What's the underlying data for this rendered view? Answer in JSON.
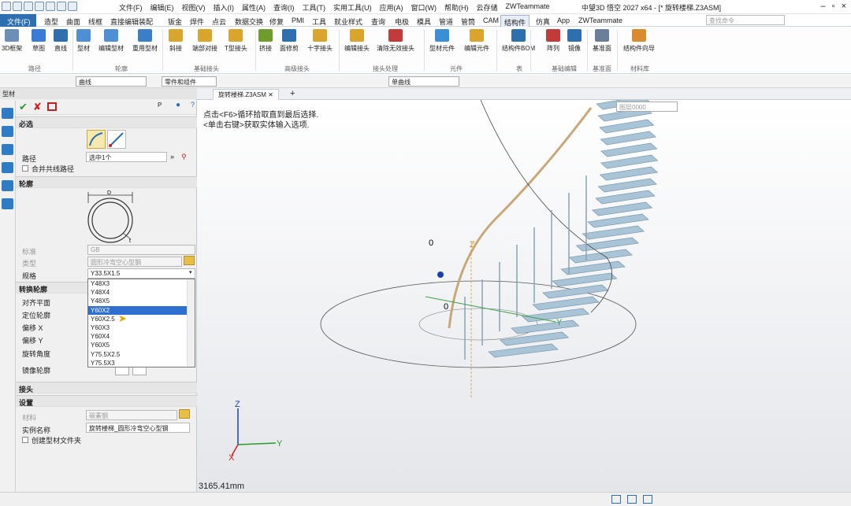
{
  "app": {
    "title": "中望3D 悟空 2027 x64 - [* 旋转楼梯.Z3ASM]"
  },
  "menu": [
    "文件(F)",
    "编辑(E)",
    "视图(V)",
    "插入(I)",
    "属性(A)",
    "查询(I)",
    "工具(T)",
    "实用工具(U)",
    "应用(A)",
    "窗口(W)",
    "帮助(H)",
    "云存储",
    "ZWTeammate"
  ],
  "ribbon_tabs": {
    "file": "文件(F)",
    "tabs": [
      "造型",
      "曲面",
      "线框",
      "直接编辑",
      "装配",
      "钣金",
      "焊件",
      "点云",
      "数据交换",
      "修复",
      "PMI",
      "工具",
      "就业样式",
      "查询",
      "电极",
      "模具",
      "管道",
      "管筒",
      "CAM",
      "结构件",
      "仿真",
      "App",
      "ZWTeammate"
    ]
  },
  "search_placeholder": "查找命令",
  "ribbon": {
    "buttons": [
      "3D框架",
      "草图",
      "直线",
      "型材",
      "编辑型材",
      "重用型材",
      "斜接",
      "端部对接",
      "T型接头",
      "挤接",
      "面修剪",
      "十字接头",
      "编辑接头",
      "清除无效接头",
      "型材元件",
      "编辑元件",
      "结构件BOM",
      "阵列",
      "镜像",
      "基准面",
      "结构件向导"
    ],
    "groups": [
      "路径",
      "轮廓",
      "基础接头",
      "高级接头",
      "接头处理",
      "元件",
      "表",
      "基础编辑",
      "基准面",
      "材料库"
    ]
  },
  "toolbar2": {
    "filter": "曲线",
    "filter2": "零件和组件",
    "select_mode": "单曲线",
    "layer": "图层0000"
  },
  "panel": {
    "title": "型材",
    "sec_required": "必选",
    "path_label": "路径",
    "path_value": "选中1个",
    "merge_label": "合并共线路径",
    "sec_profile": "轮廓",
    "dim_d": "D",
    "dim_t": "t",
    "std_label": "标准",
    "std_value": "GB",
    "type_label": "类型",
    "type_value": "圆形冷弯空心型钢",
    "spec_label": "规格",
    "spec_value": "Y33.5X1.5",
    "sec_transform": "转换轮廓",
    "align_label": "对齐平面",
    "locate_label": "定位轮廓",
    "offx_label": "偏移 X",
    "offy_label": "偏移 Y",
    "rot_label": "旋转角度",
    "mirror_label": "镜像轮廓",
    "sec_joint": "接头",
    "sec_settings": "设置",
    "mat_label": "材料",
    "mat_value": "碳素钢",
    "inst_label": "实例名称",
    "inst_value": "旋转楼梯_圆形冷弯空心型钢",
    "create_label": "创建型材文件夹"
  },
  "dropdown": {
    "items": [
      "Y48X3",
      "Y48X4",
      "Y48X5",
      "Y60X2",
      "Y60X2.5",
      "Y60X3",
      "Y60X4",
      "Y60X5",
      "Y75.5X2.5",
      "Y75.5X3"
    ],
    "selected": "Y60X2"
  },
  "doc_tab": "旋转楼梯.Z3ASM",
  "hint": {
    "line1": "点击<F6>循环拾取直到最后选择.",
    "line2": "<单击右键>获取实体输入选项."
  },
  "axes": {
    "z": "Z",
    "y": "Y",
    "x": "X",
    "zero": "0"
  },
  "distance": "3165.41mm",
  "colors": {
    "accent": "#2e6fb0",
    "selection": "#2f6fd0",
    "stairs": "#a9c4d6",
    "stairs_dark": "#6f8ea3"
  }
}
